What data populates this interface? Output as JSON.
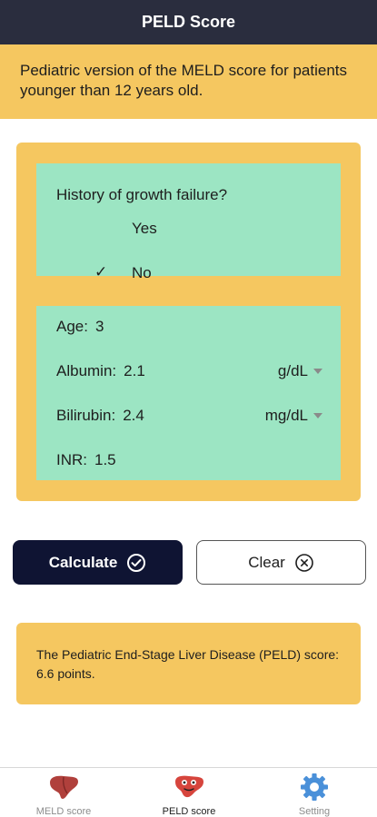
{
  "header": {
    "title": "PELD Score"
  },
  "intro": {
    "text": "Pediatric version of the MELD score for patients younger than 12 years old."
  },
  "growth": {
    "question": "History of growth failure?",
    "options": [
      {
        "label": "Yes",
        "selected": false
      },
      {
        "label": "No",
        "selected": true
      }
    ],
    "check_mark": "✓"
  },
  "inputs": {
    "age": {
      "label": "Age:",
      "value": "3"
    },
    "albumin": {
      "label": "Albumin:",
      "value": "2.1",
      "unit": "g/dL"
    },
    "bilirubin": {
      "label": "Bilirubin:",
      "value": "2.4",
      "unit": "mg/dL"
    },
    "inr": {
      "label": "INR:",
      "value": "1.5"
    }
  },
  "actions": {
    "calculate_label": "Calculate",
    "calculate_icon": "check-circle-icon",
    "clear_label": "Clear",
    "clear_icon": "close-circle-icon"
  },
  "result": {
    "text": "The Pediatric End-Stage Liver Disease (PELD) score: 6.6 points."
  },
  "tabbar": {
    "items": [
      {
        "label": "MELD score",
        "icon": "liver-icon",
        "active": false
      },
      {
        "label": "PELD score",
        "icon": "liver-face-icon",
        "active": true
      },
      {
        "label": "Setting",
        "icon": "gear-icon",
        "active": false
      }
    ]
  },
  "colors": {
    "header_bg": "#2a2d3e",
    "accent_yellow": "#f5c760",
    "panel_green": "#9ce5c3",
    "primary_button": "#0f1433"
  }
}
